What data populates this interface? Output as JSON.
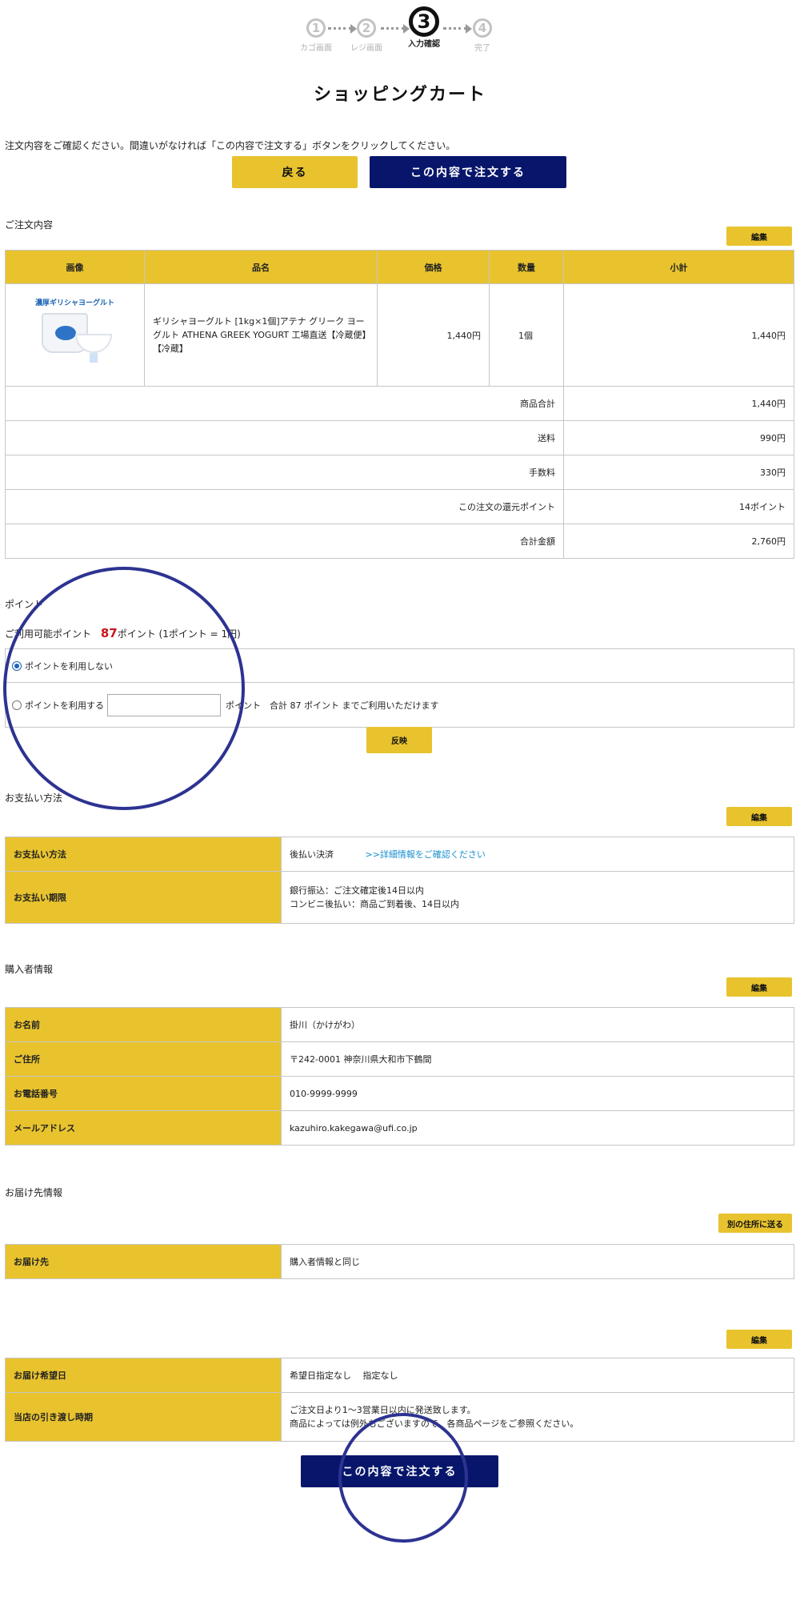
{
  "stepper": {
    "steps": [
      {
        "num": "1",
        "label": "カゴ画面"
      },
      {
        "num": "2",
        "label": "レジ画面"
      },
      {
        "num": "3",
        "label": "入力確認"
      },
      {
        "num": "4",
        "label": "完了"
      }
    ],
    "active_step": 3
  },
  "page_title": "ショッピングカート",
  "notice": "注文内容をご確認ください。間違いがなければ「この内容で注文する」ボタンをクリックしてください。",
  "buttons": {
    "back": "戻る",
    "order": "この内容で注文する",
    "edit": "編集",
    "apply": "反映",
    "other_address": "別の住所に送る"
  },
  "order": {
    "section_title": "ご注文内容",
    "headers": {
      "image": "画像",
      "name": "品名",
      "price": "価格",
      "qty": "数量",
      "subtotal": "小計"
    },
    "item": {
      "image_caption": "濃厚ギリシャヨーグルト",
      "name": "ギリシャヨーグルト [1kg×1個]アテナ グリーク ヨーグルト ATHENA GREEK YOGURT 工場直送【冷蔵便】【冷蔵】",
      "price": "1,440円",
      "qty": "1個",
      "subtotal": "1,440円"
    },
    "summary": [
      {
        "label": "商品合計",
        "value": "1,440円"
      },
      {
        "label": "送料",
        "value": "990円"
      },
      {
        "label": "手数料",
        "value": "330円"
      },
      {
        "label": "この注文の還元ポイント",
        "value": "14ポイント"
      },
      {
        "label": "合計金額",
        "value": "2,760円"
      }
    ]
  },
  "points": {
    "section_title": "ポイント",
    "available_label": "ご利用可能ポイント",
    "available_value": "87",
    "available_suffix": "ポイント (1ポイント = 1円)",
    "option_none": "ポイントを利用しない",
    "option_use": "ポイントを利用する",
    "input_value": "",
    "suffix": "ポイント　合計 87 ポイント までご利用いただけます",
    "selected": "none"
  },
  "payment": {
    "section_title": "お支払い方法",
    "rows": [
      {
        "label": "お支払い方法",
        "value": "後払い決済",
        "link": ">>詳細情報をご確認ください"
      },
      {
        "label": "お支払い期限",
        "line1": "銀行振込：ご注文確定後14日以内",
        "line2": "コンビニ後払い：商品ご到着後、14日以内"
      }
    ]
  },
  "buyer": {
    "section_title": "購入者情報",
    "rows": [
      {
        "label": "お名前",
        "value": "掛川（かけがわ）"
      },
      {
        "label": "ご住所",
        "value": "〒242-0001  神奈川県大和市下鶴間"
      },
      {
        "label": "お電話番号",
        "value": "010-9999-9999"
      },
      {
        "label": "メールアドレス",
        "value": "kazuhiro.kakegawa@ufi.co.jp"
      }
    ]
  },
  "delivery": {
    "section_title": "お届け先情報",
    "rows": [
      {
        "label": "お届け先",
        "value": "購入者情報と同じ"
      }
    ]
  },
  "schedule": {
    "rows": [
      {
        "label": "お届け希望日",
        "value": "希望日指定なし　 指定なし"
      },
      {
        "label": "当店の引き渡し時期",
        "line1": "ご注文日より1〜3営業日以内に発送致します。",
        "line2": "商品によっては例外もございますので、各商品ページをご参照ください。"
      }
    ]
  },
  "colors": {
    "accent_yellow": "#e8c32e",
    "primary_navy": "#07166b",
    "points_red": "#c9151e",
    "link_blue": "#1a8fd0",
    "annotation_circle": "#2d3391"
  }
}
